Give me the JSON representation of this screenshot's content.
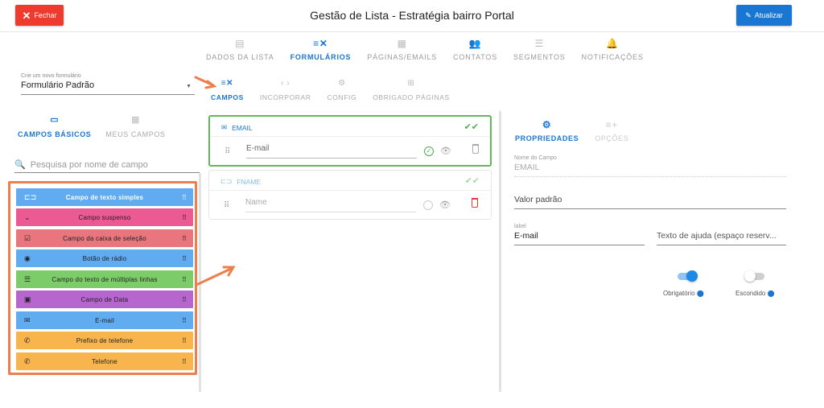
{
  "header": {
    "close_label": "Fechar",
    "title": "Gestão de Lista - Estratégia bairro Portal",
    "update_label": "Atualizar"
  },
  "main_tabs": [
    {
      "label": "DADOS DA LISTA",
      "icon": "list-icon"
    },
    {
      "label": "FORMULÁRIOS",
      "icon": "form-icon",
      "active": true
    },
    {
      "label": "PÁGINAS/EMAILS",
      "icon": "pages-icon"
    },
    {
      "label": "CONTATOS",
      "icon": "contacts-icon"
    },
    {
      "label": "SEGMENTOS",
      "icon": "filter-icon"
    },
    {
      "label": "NOTIFICAÇÕES",
      "icon": "bell-icon"
    }
  ],
  "form_select": {
    "label": "Crie um novo formulário",
    "value": "Formulário Padrão"
  },
  "left_tabs": [
    {
      "label": "CAMPOS BÁSICOS",
      "icon": "input-icon",
      "active": true
    },
    {
      "label": "MEUS CAMPOS",
      "icon": "grid-icon"
    }
  ],
  "field_search": {
    "placeholder": "Pesquisa por nome de campo"
  },
  "palette": [
    {
      "label": "Campo de texto simples",
      "icon": "text-field-icon",
      "color": "#61abf1"
    },
    {
      "label": "Campo suspenso",
      "icon": "chevron-down-icon",
      "color": "#ec5a93"
    },
    {
      "label": "Campo da caixa de seleção",
      "icon": "checkbox-icon",
      "color": "#e9767e"
    },
    {
      "label": "Botão de rádio",
      "icon": "radio-icon",
      "color": "#61abf1"
    },
    {
      "label": "Campo do texto de múltiplas linhas",
      "icon": "multiline-icon",
      "color": "#7dcc6a"
    },
    {
      "label": "Campo de Data",
      "icon": "calendar-icon",
      "color": "#b765cf"
    },
    {
      "label": "E-mail",
      "icon": "email-icon",
      "color": "#61abf1"
    },
    {
      "label": "Prefixo de telefone",
      "icon": "phone-icon",
      "color": "#f8b54d"
    },
    {
      "label": "Telefone",
      "icon": "phone-icon",
      "color": "#f8b54d"
    }
  ],
  "sub_tabs": [
    {
      "label": "CAMPOS",
      "icon": "fields-icon",
      "active": true
    },
    {
      "label": "INCORPORAR",
      "icon": "code-icon"
    },
    {
      "label": "CONFIG",
      "icon": "gear-icon"
    },
    {
      "label": "OBRIGADO PÁGINAS",
      "icon": "thanks-page-icon"
    }
  ],
  "form_fields": [
    {
      "name": "EMAIL",
      "input_label": "E-mail"
    },
    {
      "name": "FNAME",
      "input_label": "Name"
    }
  ],
  "right_tabs": [
    {
      "label": "PROPRIEDADES",
      "icon": "gears-icon",
      "active": true
    },
    {
      "label": "OPÇÕES",
      "icon": "playlist-add-icon"
    }
  ],
  "properties": {
    "field_name_label": "Nome do Campo",
    "field_name_value": "EMAIL",
    "default_value_placeholder": "Valor padrão",
    "label_label": "label",
    "label_value": "E-mail",
    "help_text_placeholder": "Texto de ajuda (espaço reserv...",
    "required_label": "Obrigatório",
    "required_on": true,
    "hidden_label": "Escondido",
    "hidden_on": false
  },
  "colors": {
    "primary": "#1976d2",
    "close_button": "#ef3b2d",
    "annotation": "#ee7f4d",
    "success": "#4caf50"
  }
}
